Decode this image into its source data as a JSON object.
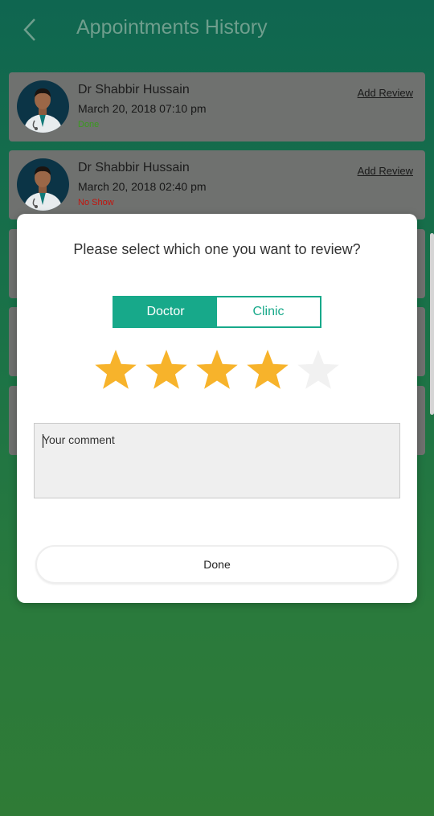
{
  "header": {
    "title": "Appointments History"
  },
  "appointments": [
    {
      "doctor": "Dr Shabbir Hussain",
      "datetime": "March 20, 2018 07:10 pm",
      "status": "Done",
      "status_color": "#3a9a1f",
      "action": "Add Review"
    },
    {
      "doctor": "Dr Shabbir Hussain",
      "datetime": "March 20, 2018 02:40 pm",
      "status": "No Show",
      "status_color": "#c4140e",
      "action": "Add Review"
    }
  ],
  "modal": {
    "question": "Please select which one you want to review?",
    "options": [
      "Doctor",
      "Clinic"
    ],
    "selected_option": "Doctor",
    "rating": 4,
    "max_rating": 5,
    "comment_placeholder": "Your comment",
    "done_label": "Done"
  },
  "colors": {
    "accent": "#17a98a",
    "star_filled": "#f7b32b",
    "star_empty": "#f1f1f1"
  }
}
